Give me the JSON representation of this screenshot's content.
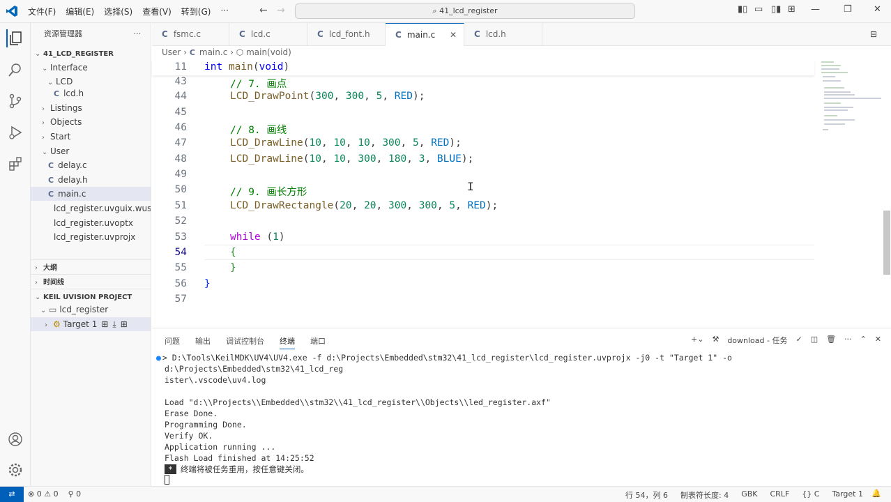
{
  "titlebar": {
    "menu": [
      "文件(F)",
      "编辑(E)",
      "选择(S)",
      "查看(V)",
      "转到(G)",
      "···"
    ],
    "search_text": "41_lcd_register"
  },
  "sidebar": {
    "header": "资源管理器",
    "tree": [
      {
        "label": "41_LCD_REGISTER",
        "kind": "root"
      },
      {
        "label": "Interface",
        "kind": "folder"
      },
      {
        "label": "LCD",
        "kind": "folder"
      },
      {
        "label": "lcd.h",
        "kind": "file"
      },
      {
        "label": "Listings",
        "kind": "folder"
      },
      {
        "label": "Objects",
        "kind": "folder"
      },
      {
        "label": "Start",
        "kind": "folder"
      },
      {
        "label": "User",
        "kind": "folder"
      },
      {
        "label": "delay.c",
        "kind": "file"
      },
      {
        "label": "delay.h",
        "kind": "file"
      },
      {
        "label": "main.c",
        "kind": "file"
      },
      {
        "label": "lcd_register.uvguix.wush...",
        "kind": "file"
      },
      {
        "label": "lcd_register.uvoptx",
        "kind": "file"
      },
      {
        "label": "lcd_register.uvprojx",
        "kind": "file"
      }
    ],
    "sections": [
      "大纲",
      "时间线",
      "KEIL UVISION PROJECT"
    ],
    "project": "lcd_register",
    "target": "Target 1"
  },
  "tabs": [
    {
      "label": "fsmc.c"
    },
    {
      "label": "lcd.c"
    },
    {
      "label": "lcd_font.h"
    },
    {
      "label": "main.c",
      "close": "✕"
    },
    {
      "label": "lcd.h"
    }
  ],
  "breadcrumb": {
    "folder": "User",
    "file": "main.c",
    "symbol": "main(void)"
  },
  "editor": {
    "sticky": {
      "line": "11",
      "text": "int main(void)"
    },
    "lines": [
      {
        "n": "43",
        "text": "// 7. 画点"
      },
      {
        "n": "44",
        "text": "LCD_DrawPoint(300, 300, 5, RED);"
      },
      {
        "n": "45",
        "text": ""
      },
      {
        "n": "46",
        "text": "// 8. 画线"
      },
      {
        "n": "47",
        "text": "LCD_DrawLine(10, 10, 10, 300, 5, RED);"
      },
      {
        "n": "48",
        "text": "LCD_DrawLine(10, 10, 300, 180, 3, BLUE);"
      },
      {
        "n": "49",
        "text": ""
      },
      {
        "n": "50",
        "text": "// 9. 画长方形"
      },
      {
        "n": "51",
        "text": "LCD_DrawRectangle(20, 20, 300, 300, 5, RED);"
      },
      {
        "n": "52",
        "text": ""
      },
      {
        "n": "53",
        "text": "while (1)"
      },
      {
        "n": "54",
        "text": "{"
      },
      {
        "n": "55",
        "text": "}"
      },
      {
        "n": "56",
        "text": "}"
      },
      {
        "n": "57",
        "text": ""
      }
    ]
  },
  "panel": {
    "tabs": [
      "问题",
      "输出",
      "调试控制台",
      "终端",
      "端口"
    ],
    "task": "download - 任务",
    "terminal": [
      "> D:\\Tools\\KeilMDK\\UV4\\UV4.exe -f d:\\Projects\\Embedded\\stm32\\41_lcd_register\\lcd_register.uvprojx -j0 -t \"Target 1\" -o d:\\Projects\\Embedded\\stm32\\41_lcd_reg",
      "ister\\.vscode\\uv4.log",
      "",
      "Load \"d:\\\\Projects\\\\Embedded\\\\stm32\\\\41_lcd_register\\\\Objects\\\\led_register.axf\"",
      "Erase Done.",
      "Programming Done.",
      "Verify OK.",
      "Application running ...",
      "Flash Load finished at 14:25:52"
    ],
    "notice_star": "*",
    "notice": "终端将被任务重用，按任意键关闭。"
  },
  "status": {
    "errors": "0",
    "warnings": "0",
    "ports": "0",
    "position": "行 54，列 6",
    "tab_size": "制表符长度: 4",
    "encoding": "GBK",
    "eol": "CRLF",
    "language": "{} C",
    "target": "Target 1"
  },
  "colors": {
    "accent": "#005fb8",
    "keyword": "#0000ff",
    "comment": "#008000",
    "number": "#098658"
  }
}
